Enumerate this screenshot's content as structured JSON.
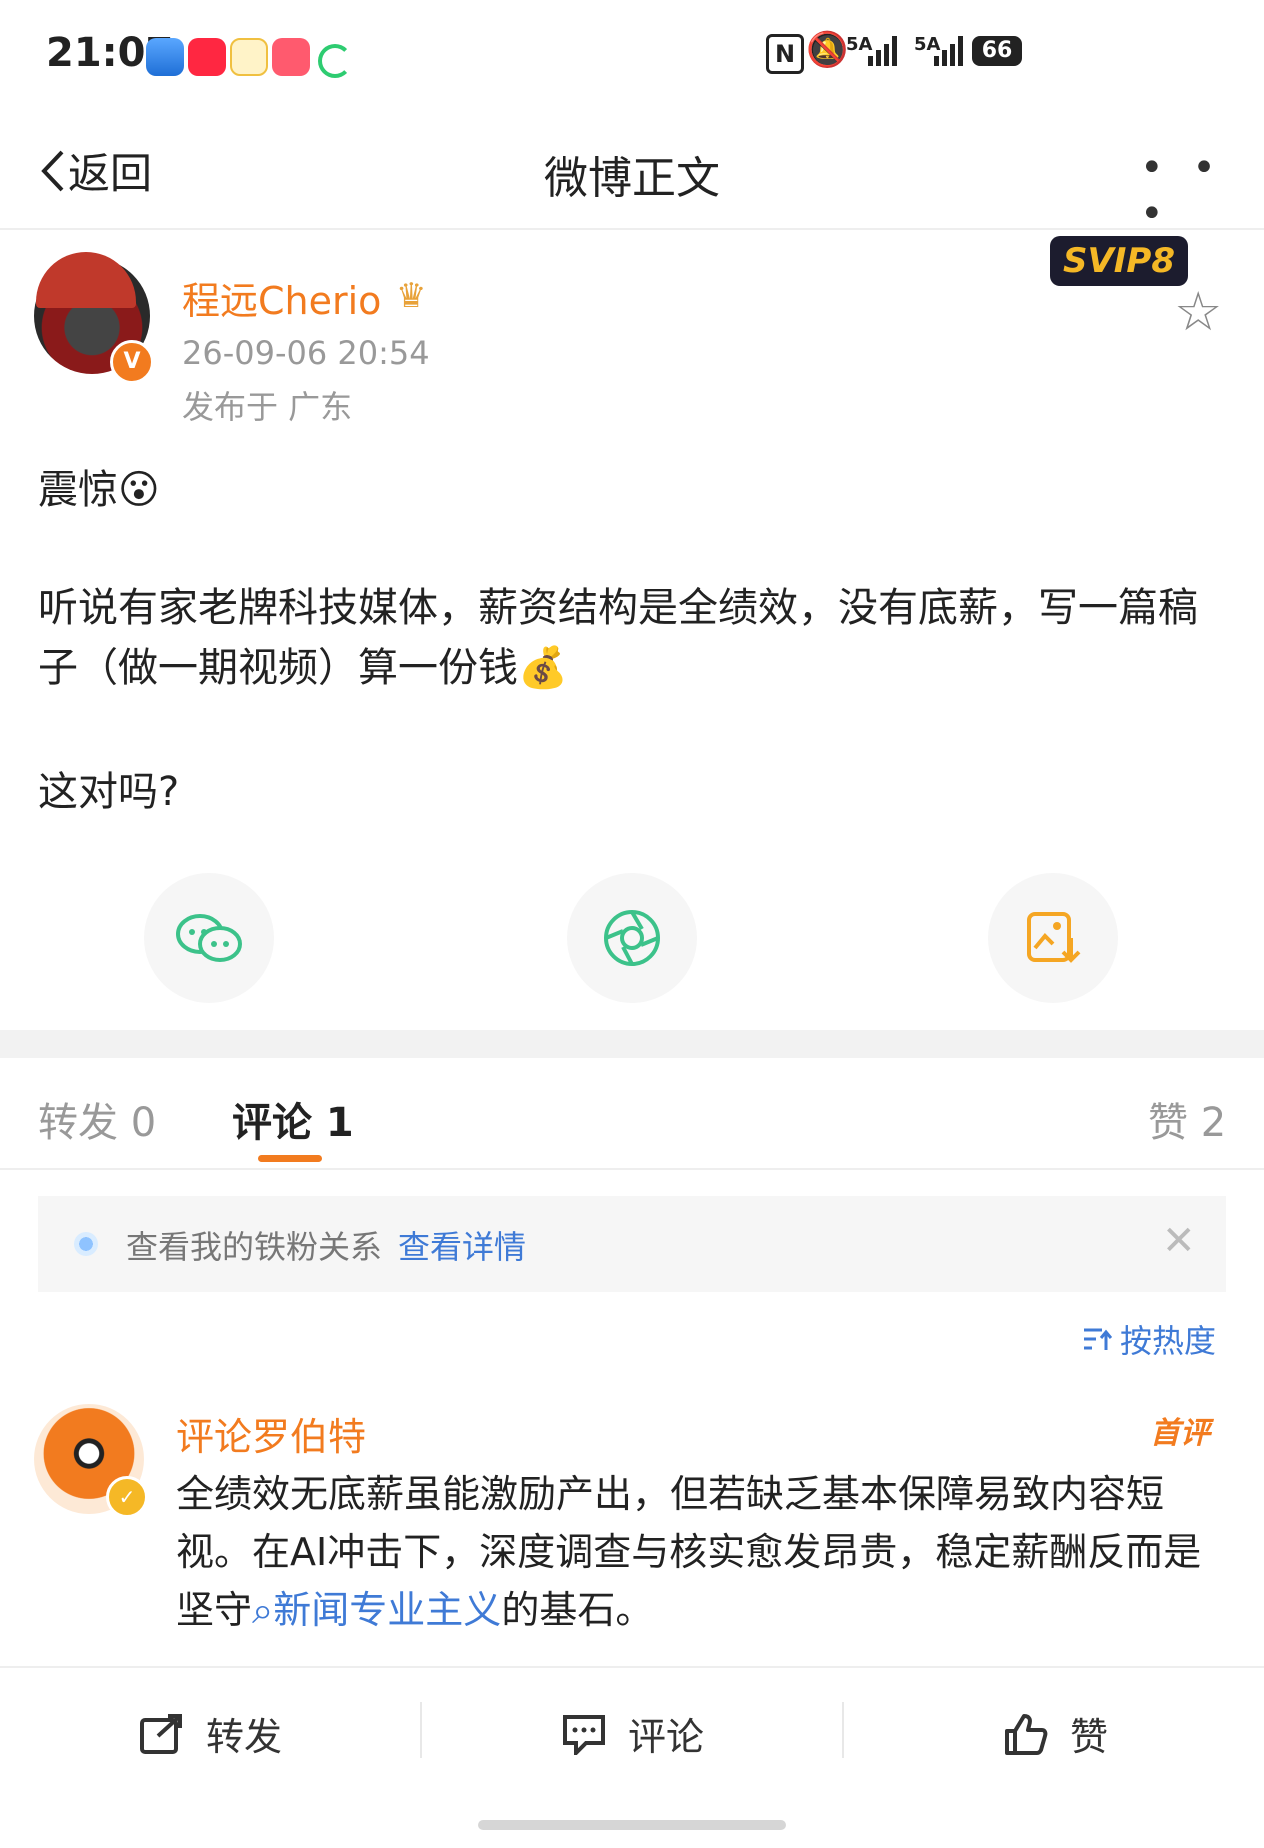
{
  "status_bar": {
    "time": "21:07",
    "signal1": "5A",
    "signal2": "5A",
    "battery": "66"
  },
  "header": {
    "back_label": "返回",
    "title": "微博正文",
    "more": "• • •"
  },
  "post": {
    "author": "程远Cherio",
    "date": "26-09-06 20:54",
    "location": "发布于 广东",
    "badge": "SVIP8",
    "verified": "V",
    "head": "震惊😮",
    "body": "听说有家老牌科技媒体，薪资结构是全绩效，没有底薪，写一篇稿子（做一期视频）算一份钱💰",
    "question": "这对吗?"
  },
  "tabs": {
    "repost": "转发 0",
    "comment": "评论 1",
    "like": "赞 2"
  },
  "fans_banner": {
    "text": "查看我的铁粉关系",
    "link": "查看详情",
    "close": "✕"
  },
  "sort": {
    "label": "按热度"
  },
  "comment": {
    "name": "评论罗伯特",
    "first_tag": "首评",
    "text_before": "全绩效无底薪虽能激励产出，但若缺乏基本保障易致内容短视。在AI冲击下，深度调查与核实愈发昂贵，稳定薪酬反而是坚守",
    "link_text": "新闻专业主义",
    "text_after": "的基石。"
  },
  "bottom_bar": {
    "repost": "转发",
    "comment": "评论",
    "like": "赞"
  },
  "colors": {
    "accent": "#f27b1f",
    "link": "#3f7ad6",
    "muted": "#999999"
  }
}
